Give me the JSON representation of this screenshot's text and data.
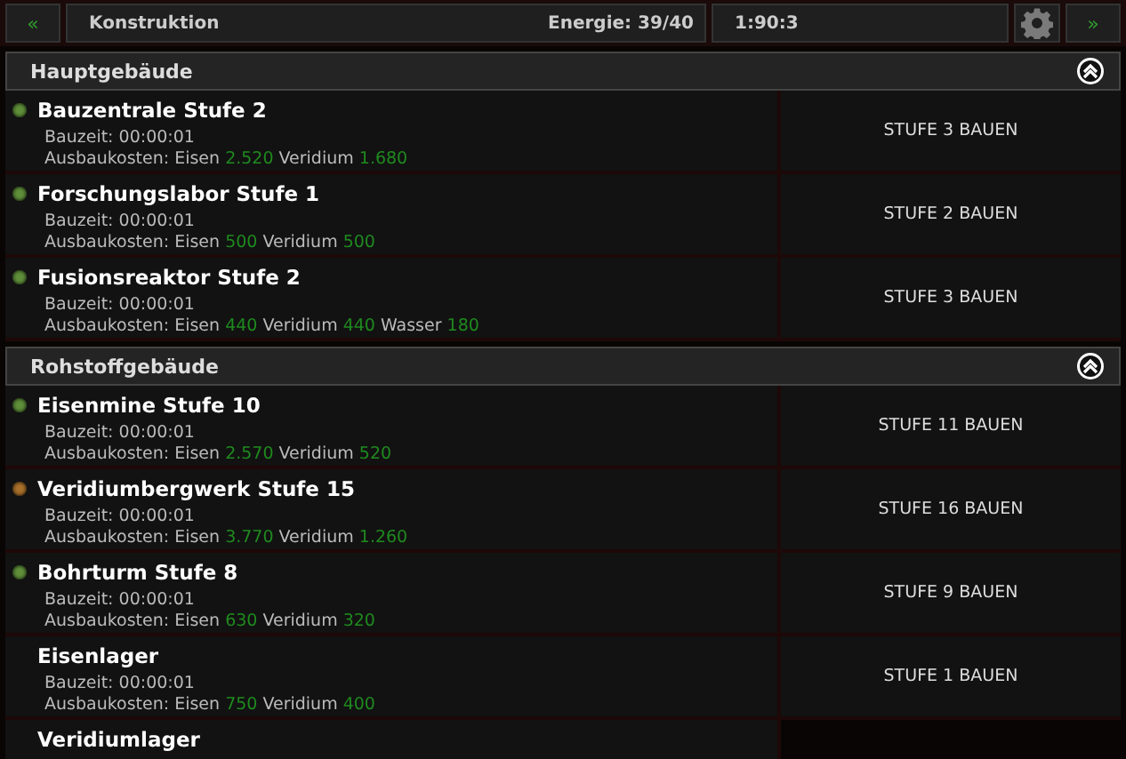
{
  "top_bar": {
    "prev": "«",
    "title": "Konstruktion",
    "energy": "Energie: 39/40",
    "coords": "1:90:3",
    "next": "»"
  },
  "sections": [
    {
      "title": "Hauptgebäude",
      "expanded": true,
      "buildings": [
        {
          "name": "Bauzentrale Stufe 2",
          "color": "#5f8f3a",
          "time": "Bauzeit: 00:00:01",
          "costs_label": "Ausbaukosten:",
          "costs": [
            {
              "resource": "Eisen",
              "amount": "2.520"
            },
            {
              "resource": "Veridium",
              "amount": "1.680"
            }
          ],
          "action": "STUFE 3 BAUEN"
        },
        {
          "name": "Forschungslabor Stufe 1",
          "color": "#5f8f3a",
          "time": "Bauzeit: 00:00:01",
          "costs_label": "Ausbaukosten:",
          "costs": [
            {
              "resource": "Eisen",
              "amount": "500"
            },
            {
              "resource": "Veridium",
              "amount": "500"
            }
          ],
          "action": "STUFE 2 BAUEN"
        },
        {
          "name": "Fusionsreaktor Stufe 2",
          "color": "#5f8f3a",
          "time": "Bauzeit: 00:00:01",
          "costs_label": "Ausbaukosten:",
          "costs": [
            {
              "resource": "Eisen",
              "amount": "440"
            },
            {
              "resource": "Veridium",
              "amount": "440"
            },
            {
              "resource": "Wasser",
              "amount": "180"
            }
          ],
          "action": "STUFE 3 BAUEN"
        }
      ]
    },
    {
      "title": "Rohstoffgebäude",
      "expanded": true,
      "buildings": [
        {
          "name": "Eisenmine Stufe 10",
          "color": "#5f8f3a",
          "time": "Bauzeit: 00:00:01",
          "costs_label": "Ausbaukosten:",
          "costs": [
            {
              "resource": "Eisen",
              "amount": "2.570"
            },
            {
              "resource": "Veridium",
              "amount": "520"
            }
          ],
          "action": "STUFE 11 BAUEN"
        },
        {
          "name": "Veridiumbergwerk Stufe 15",
          "color": "#a8702a",
          "time": "Bauzeit: 00:00:01",
          "costs_label": "Ausbaukosten:",
          "costs": [
            {
              "resource": "Eisen",
              "amount": "3.770"
            },
            {
              "resource": "Veridium",
              "amount": "1.260"
            }
          ],
          "action": "STUFE 16 BAUEN"
        },
        {
          "name": "Bohrturm Stufe 8",
          "color": "#5f8f3a",
          "time": "Bauzeit: 00:00:01",
          "costs_label": "Ausbaukosten:",
          "costs": [
            {
              "resource": "Eisen",
              "amount": "630"
            },
            {
              "resource": "Veridium",
              "amount": "320"
            }
          ],
          "action": "STUFE 9 BAUEN"
        },
        {
          "name": "Eisenlager",
          "time": "Bauzeit: 00:00:01",
          "costs_label": "Ausbaukosten:",
          "costs": [
            {
              "resource": "Eisen",
              "amount": "750"
            },
            {
              "resource": "Veridium",
              "amount": "400"
            }
          ],
          "action": "STUFE 1 BAUEN"
        },
        {
          "name": "Veridiumlager"
        }
      ]
    }
  ]
}
